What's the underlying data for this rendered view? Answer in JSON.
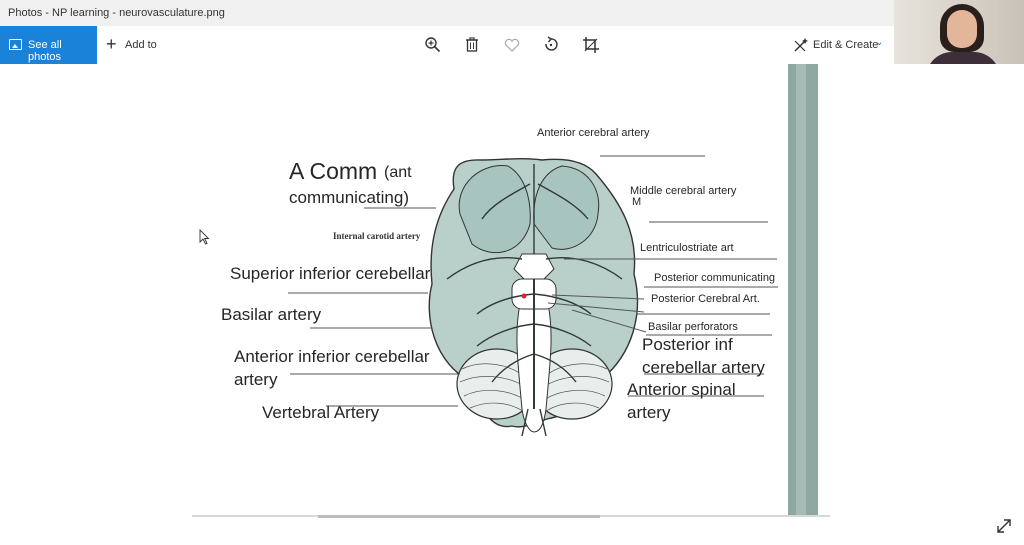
{
  "window": {
    "title": "Photos - NP learning - neurovasculature.png"
  },
  "toolbar": {
    "see_all_label": "See all photos",
    "add_to_label": "Add to",
    "zoom_icon": "zoom-in-icon",
    "delete_icon": "trash-icon",
    "favorite_icon": "heart-icon",
    "rotate_icon": "rotate-icon",
    "crop_icon": "crop-icon",
    "edit_create_label": "Edit & Create",
    "accent": "#1a82d9"
  },
  "image": {
    "printed_labels": {
      "anterior_cerebral": "Anterior cerebral artery",
      "middle_cerebral": "Middle cerebral artery",
      "lenticulostriate": "Lentriculostriate art",
      "posterior_communicating": "Posterior communicating",
      "posterior_cerebral": "Posterior Cerebral Art.",
      "basilar_perforators": "Basilar perforators",
      "internal_carotid": "Internal carotid artery"
    },
    "handwritten_labels": {
      "a_comm_line1": "A Comm",
      "a_comm_line1_small": "(ant",
      "a_comm_line2": "communicating)",
      "m": "M",
      "superior_cerebellar": "Superior inferior cerebellar",
      "basilar": "Basilar artery",
      "aica_line1": "Anterior inferior cerebellar",
      "aica_line2": "artery",
      "vertebral": "Vertebral Artery",
      "pica_line1": "Posterior inf",
      "pica_line2": "cerebellar artery",
      "anterior_spinal_line1": "Anterior spinal",
      "anterior_spinal_line2": "artery"
    }
  },
  "webcam": {
    "label": "webcam-feed"
  },
  "controls": {
    "expand_icon": "expand-icon"
  }
}
